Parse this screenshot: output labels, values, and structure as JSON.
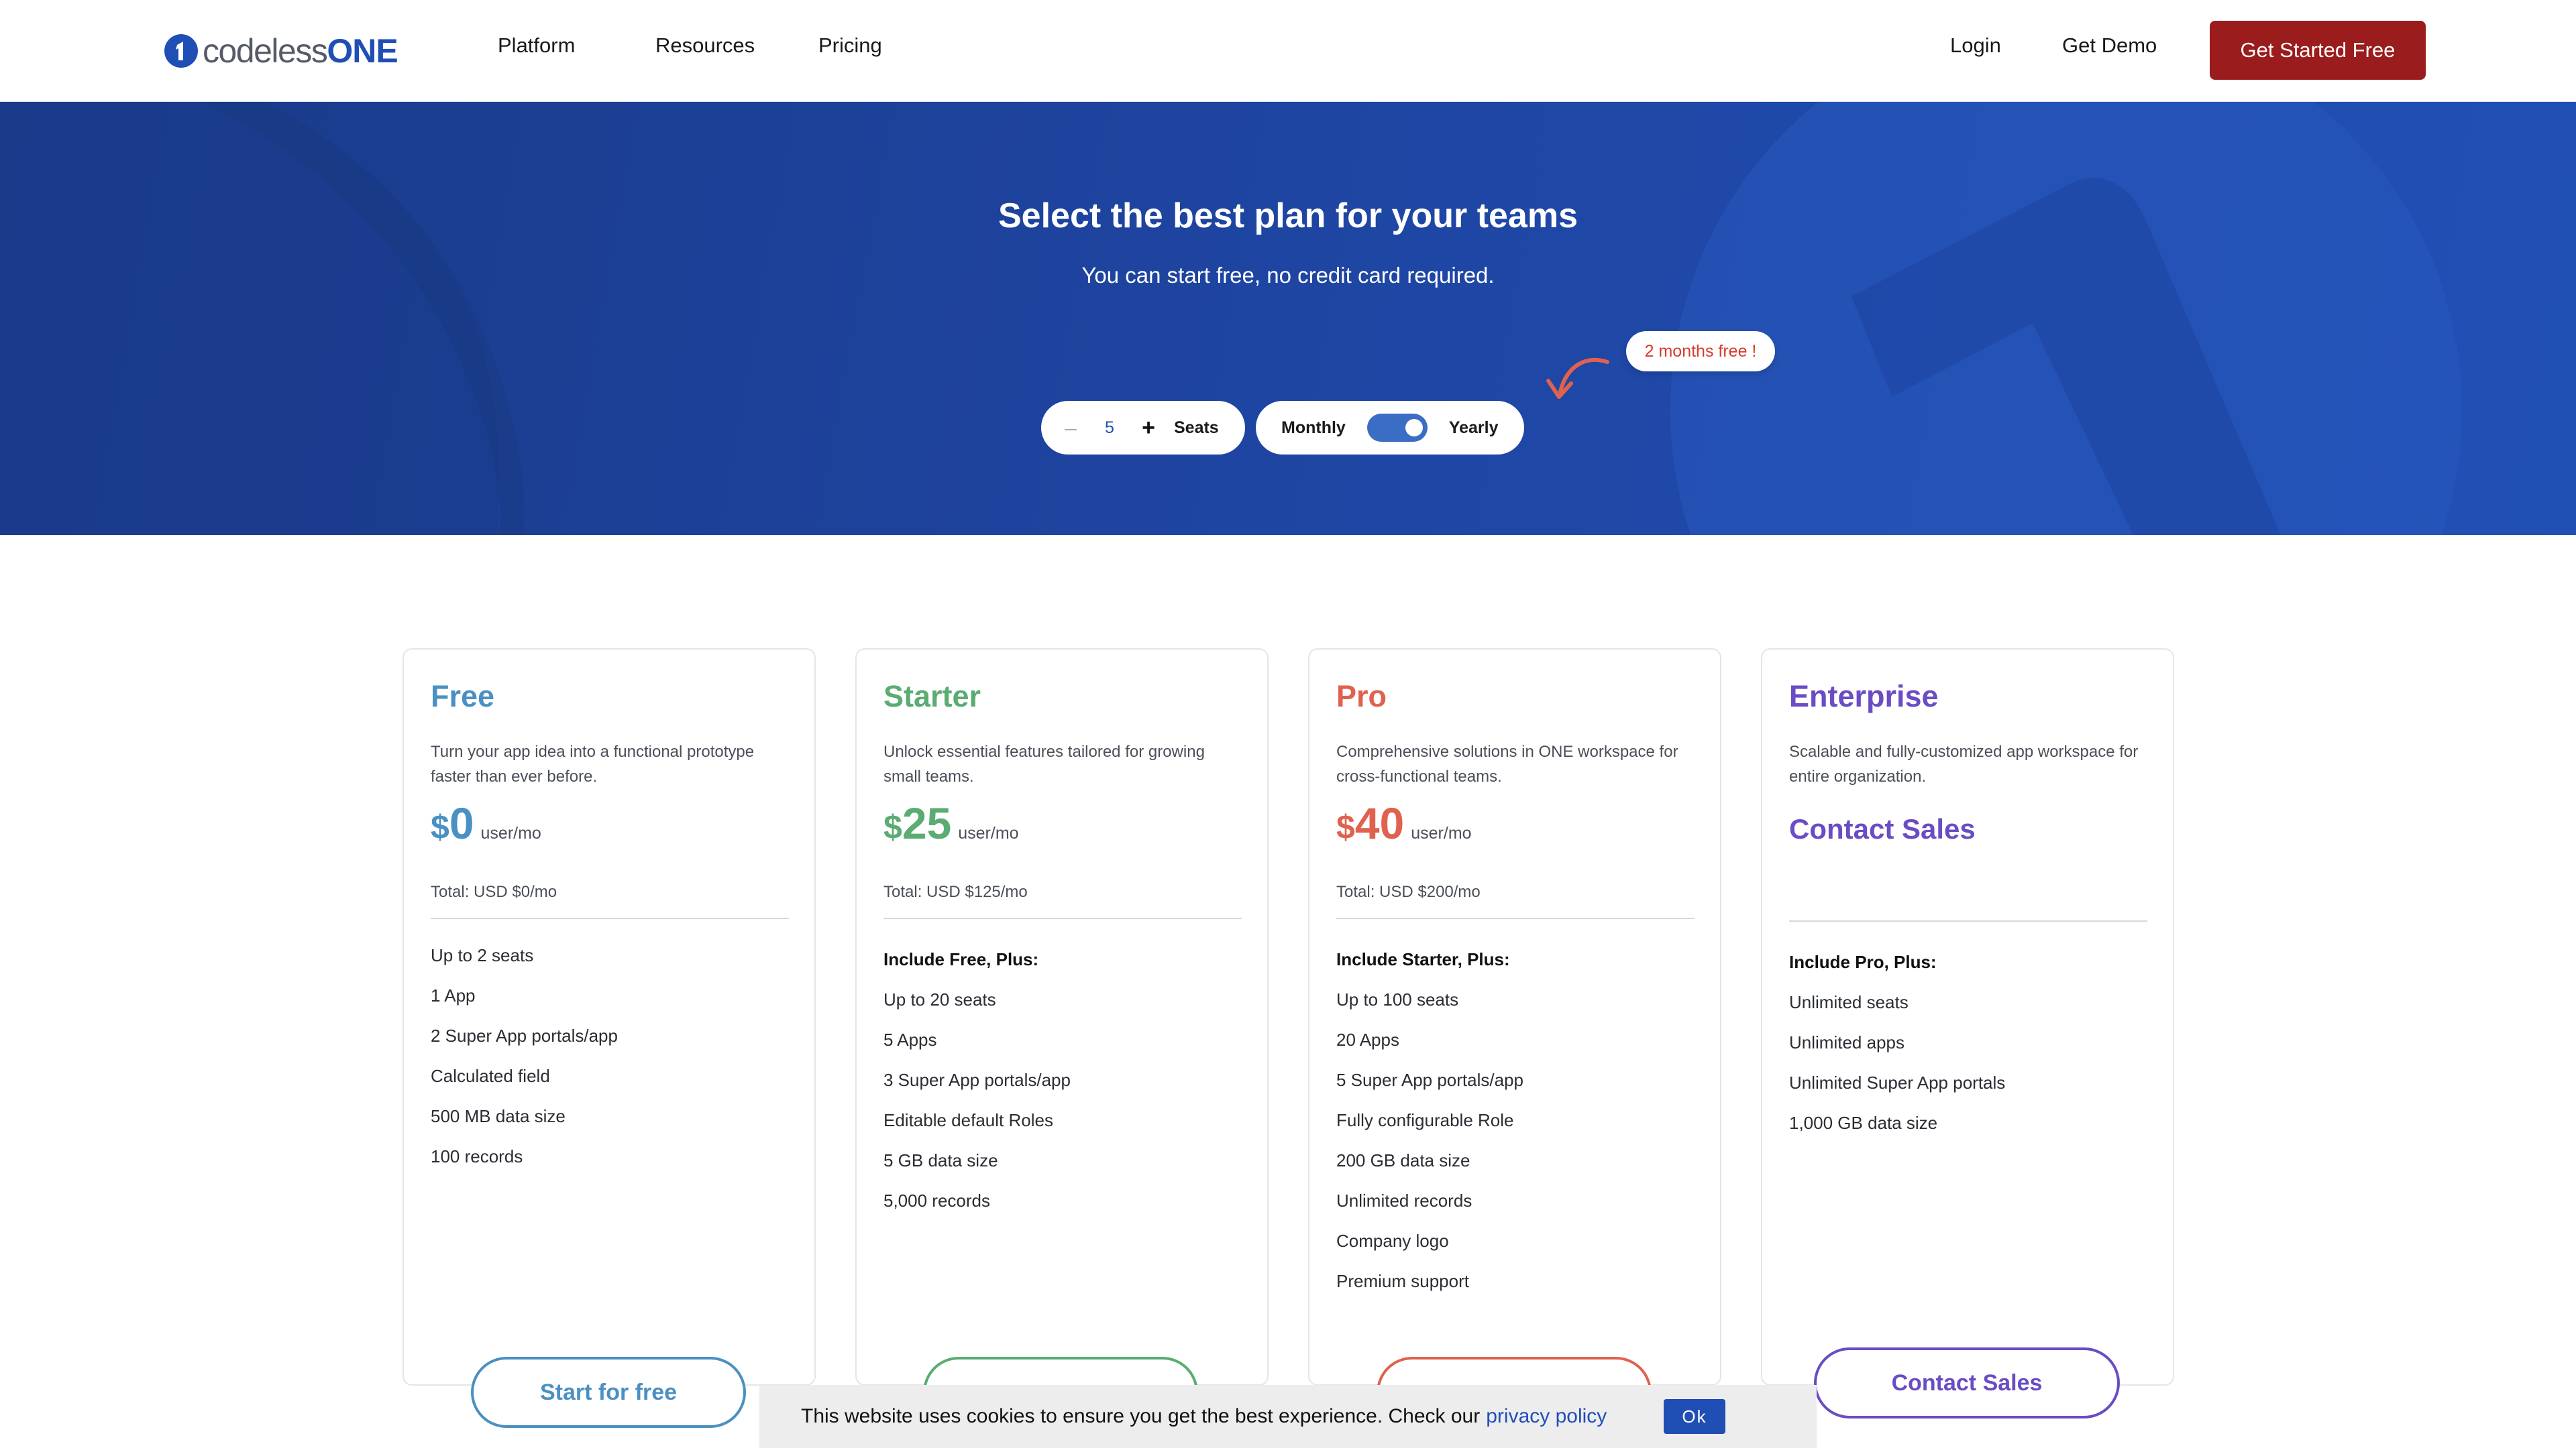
{
  "brand": {
    "logo_prefix": "codeless",
    "logo_suffix": "ONE",
    "color": "#1f4fb5"
  },
  "nav": {
    "items": [
      {
        "label": "Platform"
      },
      {
        "label": "Resources"
      },
      {
        "label": "Pricing"
      }
    ],
    "login": "Login",
    "demo": "Get Demo",
    "cta": "Get Started Free"
  },
  "hero": {
    "title": "Select the best plan for your teams",
    "subtitle": "You can start free, no credit card required.",
    "promo": "2 months free !",
    "seats": {
      "minus": "–",
      "value": "5",
      "plus": "+",
      "label": "Seats"
    },
    "billing": {
      "monthly": "Monthly",
      "yearly": "Yearly",
      "selected": "Yearly"
    }
  },
  "plans": [
    {
      "name": "Free",
      "color": "#4a90c2",
      "desc": "Turn your app idea into a functional prototype faster than ever before.",
      "currency": "$",
      "price": "0",
      "unit": "user/mo",
      "total": "Total: USD $0/mo",
      "features_head": "",
      "features": [
        "Up to 2 seats",
        "1 App",
        "2 Super App portals/app",
        "Calculated field",
        "500 MB data size",
        "100 records"
      ],
      "button": "Start for free"
    },
    {
      "name": "Starter",
      "color": "#5aac72",
      "desc": "Unlock essential features tailored for growing small teams.",
      "currency": "$",
      "price": "25",
      "unit": "user/mo",
      "total": "Total: USD $125/mo",
      "features_head": "Include Free, Plus:",
      "features": [
        "Up to 20 seats",
        "5 Apps",
        "3 Super App portals/app",
        "Editable default Roles",
        "5 GB data size",
        "5,000 records"
      ],
      "button": ""
    },
    {
      "name": "Pro",
      "color": "#e0624e",
      "desc": "Comprehensive solutions in ONE workspace for cross-functional teams.",
      "currency": "$",
      "price": "40",
      "unit": "user/mo",
      "total": "Total: USD $200/mo",
      "features_head": "Include Starter, Plus:",
      "features": [
        "Up to 100 seats",
        "20 Apps",
        "5 Super App portals/app",
        "Fully configurable Role",
        "200 GB data size",
        "Unlimited records",
        "Company logo",
        "Premium support"
      ],
      "button": ""
    },
    {
      "name": "Enterprise",
      "color": "#6a4cc4",
      "desc": "Scalable and fully-customized app workspace for entire organization.",
      "contact": "Contact Sales",
      "features_head": "Include Pro, Plus:",
      "features": [
        "Unlimited seats",
        "Unlimited apps",
        "Unlimited Super App portals",
        "1,000 GB data size"
      ],
      "button": "Contact Sales"
    }
  ],
  "cookie": {
    "text": "This website uses cookies to ensure you get the best experience. Check our",
    "link": "privacy policy",
    "ok": "Ok"
  }
}
